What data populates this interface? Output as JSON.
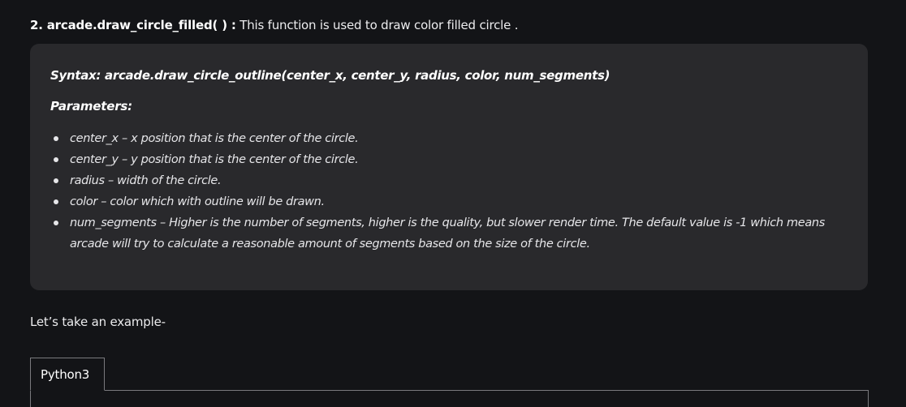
{
  "heading": {
    "function_name": "2. arcade.draw_circle_filled( ) :",
    "description": " This function is used to draw color filled circle ."
  },
  "syntax_block": {
    "syntax": "Syntax: arcade.draw_circle_outline(center_x, center_y, radius, color, num_segments)",
    "parameters_title": "Parameters:",
    "parameters": [
      "center_x  – x position that is the center of the circle.",
      "center_y  – y position that is the center of the circle.",
      "radius  – width of the circle.",
      "color – color which with outline will be drawn.",
      "num_segments – Higher is the number of segments, higher is the quality, but slower render time. The default value is -1 which means arcade will try to calculate a reasonable amount of segments based on the size of the circle."
    ]
  },
  "example_label": "Let’s take an example-",
  "code_tabs": [
    {
      "label": "Python3"
    }
  ],
  "colors": {
    "background": "#131417",
    "card": "#29292c",
    "border": "#7a7a7e"
  }
}
